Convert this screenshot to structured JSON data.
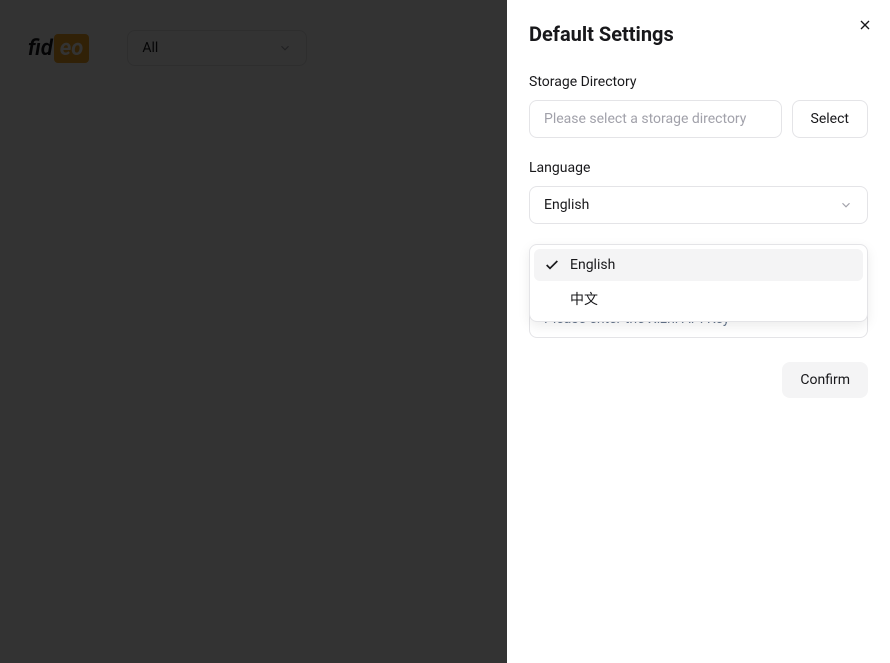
{
  "header": {
    "logo_part1": "fid",
    "logo_part2": "eo",
    "filter_value": "All"
  },
  "settings": {
    "title": "Default Settings",
    "storage": {
      "label": "Storage Directory",
      "placeholder": "Please select a storage directory",
      "select_button": "Select"
    },
    "language": {
      "label": "Language",
      "selected": "English",
      "options": [
        "English",
        "中文"
      ]
    },
    "apikey": {
      "placeholder": "Please enter the Xizhi API Key"
    },
    "confirm_button": "Confirm"
  }
}
